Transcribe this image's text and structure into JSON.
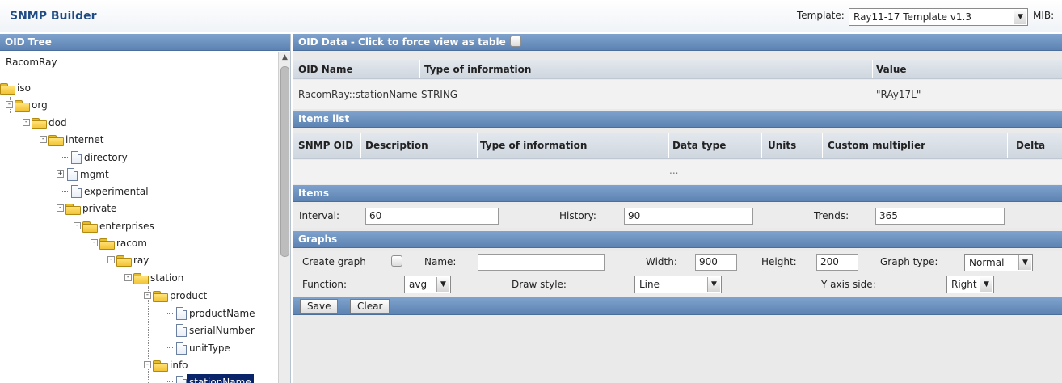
{
  "header": {
    "app_title": "SNMP Builder",
    "template_label": "Template:",
    "template_value": "Ray11-17 Template v1.3",
    "mib_label": "MIB:"
  },
  "oid_tree": {
    "title": "OID Tree",
    "root": "RacomRay",
    "nodes": [
      {
        "label": "iso",
        "type": "folder"
      },
      {
        "label": "org",
        "type": "folder",
        "toggle": "-"
      },
      {
        "label": "dod",
        "type": "folder",
        "toggle": "-"
      },
      {
        "label": "internet",
        "type": "folder",
        "toggle": "-"
      },
      {
        "label": "directory",
        "type": "file"
      },
      {
        "label": "mgmt",
        "type": "file",
        "toggle": "+"
      },
      {
        "label": "experimental",
        "type": "file"
      },
      {
        "label": "private",
        "type": "folder",
        "toggle": "-"
      },
      {
        "label": "enterprises",
        "type": "folder",
        "toggle": "-"
      },
      {
        "label": "racom",
        "type": "folder",
        "toggle": "-"
      },
      {
        "label": "ray",
        "type": "folder",
        "toggle": "-"
      },
      {
        "label": "station",
        "type": "folder",
        "toggle": "-"
      },
      {
        "label": "product",
        "type": "folder",
        "toggle": "-"
      },
      {
        "label": "productName",
        "type": "file"
      },
      {
        "label": "serialNumber",
        "type": "file"
      },
      {
        "label": "unitType",
        "type": "file"
      },
      {
        "label": "info",
        "type": "folder",
        "toggle": "-"
      },
      {
        "label": "stationName",
        "type": "file",
        "selected": true
      }
    ]
  },
  "oid_data": {
    "title": "OID Data - Click to force view as table",
    "columns": [
      "OID Name",
      "Type of information",
      "Value"
    ],
    "row": [
      "RacomRay::stationName",
      "STRING",
      "\"RAy17L\""
    ]
  },
  "items_list": {
    "title": "Items list",
    "columns": [
      "SNMP OID",
      "Description",
      "Type of information",
      "Data type",
      "Units",
      "Custom multiplier",
      "Delta"
    ],
    "placeholder_row": "..."
  },
  "items": {
    "title": "Items",
    "interval_label": "Interval:",
    "interval_value": "60",
    "history_label": "History:",
    "history_value": "90",
    "trends_label": "Trends:",
    "trends_value": "365"
  },
  "graphs": {
    "title": "Graphs",
    "create_graph_label": "Create graph",
    "name_label": "Name:",
    "name_value": "",
    "width_label": "Width:",
    "width_value": "900",
    "height_label": "Height:",
    "height_value": "200",
    "graph_type_label": "Graph type:",
    "graph_type_value": "Normal",
    "function_label": "Function:",
    "function_value": "avg",
    "draw_style_label": "Draw style:",
    "draw_style_value": "Line",
    "y_axis_side_label": "Y axis side:",
    "y_axis_side_value": "Right"
  },
  "actions": {
    "save_label": "Save",
    "clear_label": "Clear"
  }
}
